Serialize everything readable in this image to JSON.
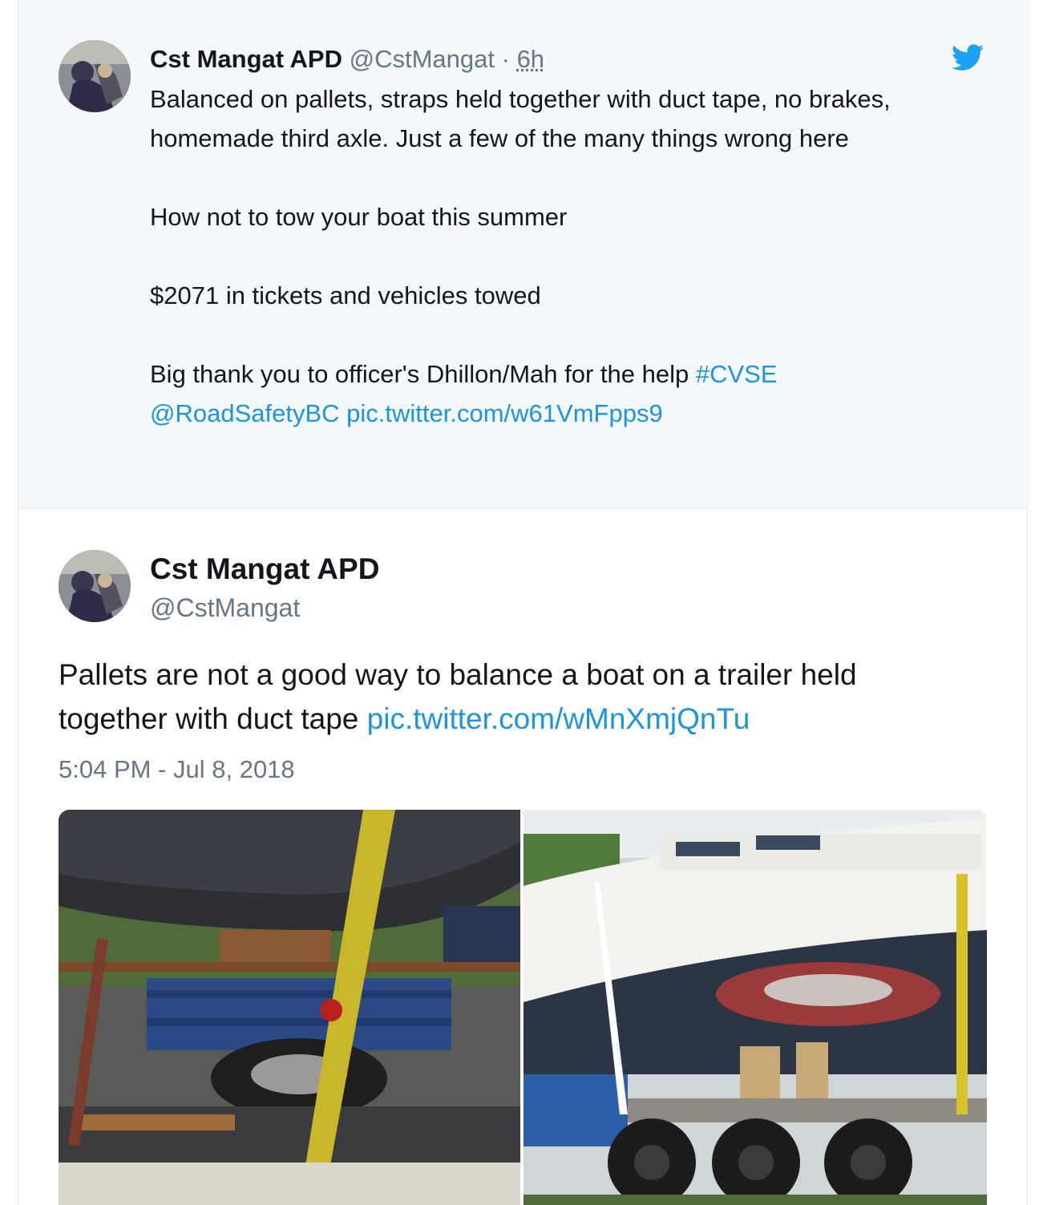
{
  "quoted_tweet": {
    "author_name": "Cst Mangat APD",
    "handle": "@CstMangat",
    "separator": "·",
    "time": "6h",
    "lines": [
      "Balanced on pallets, straps held together with duct tape, no brakes, homemade third axle. Just a few of the many things wrong here",
      "How not to tow your boat this summer",
      "$2071 in tickets and vehicles towed",
      "Big thank you to officer's Dhillon/Mah for the help"
    ],
    "hashtag": "#CVSE",
    "mention": "@RoadSafetyBC",
    "pic_link": "pic.twitter.com/w61VmFpps9",
    "brand_icon": "twitter-bird-icon",
    "accent_color": "#1da1f2"
  },
  "main_tweet": {
    "author_name": "Cst Mangat APD",
    "handle": "@CstMangat",
    "text": "Pallets are not a good way to balance a boat on a trailer held together with duct tape",
    "pic_link": "pic.twitter.com/wMnXmjQnTu",
    "timestamp": "5:04 PM - Jul 8, 2018"
  },
  "photos": [
    {
      "subject": "boat-hull-on-pallets-photo"
    },
    {
      "subject": "boat-on-triple-axle-trailer-photo"
    }
  ],
  "colors": {
    "link": "#1b95e0",
    "secondary_text": "#657786",
    "quoted_background": "#f5f8fa"
  }
}
